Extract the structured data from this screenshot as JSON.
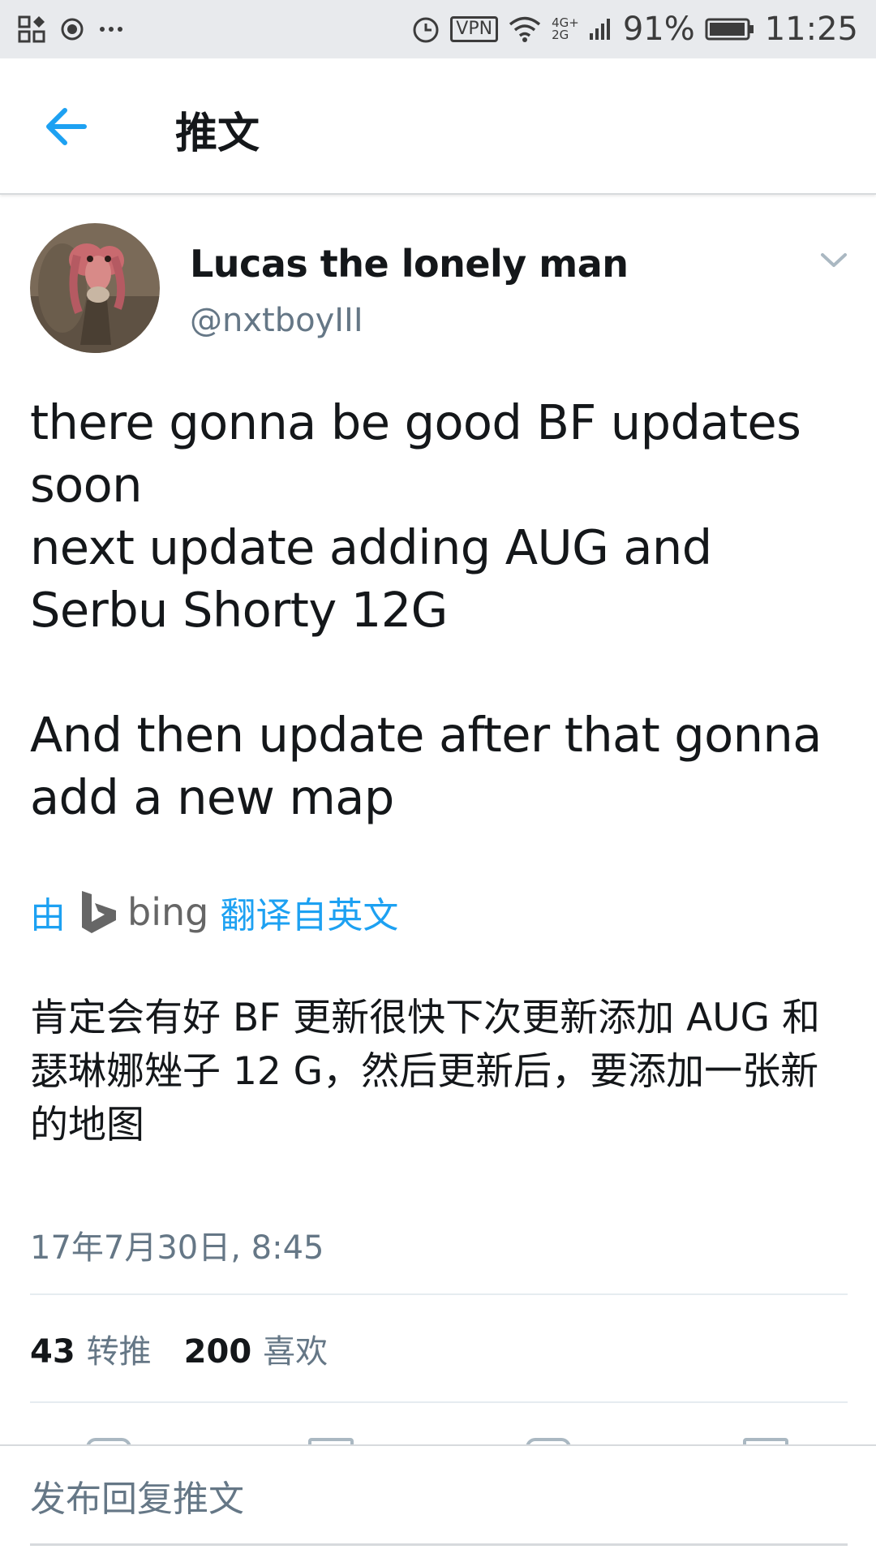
{
  "status_bar": {
    "vpn_label": "VPN",
    "network_top": "4G+",
    "network_bottom": "2G",
    "sim_slot": "2",
    "battery": "91%",
    "time": "11:25",
    "left_icons": [
      "app-grid-icon",
      "record-icon",
      "more-dots-icon"
    ],
    "right_icons": [
      "alarm-icon",
      "vpn-icon",
      "wifi-icon",
      "signal-icon",
      "battery-icon"
    ]
  },
  "header": {
    "title": "推文",
    "back_icon": "arrow-left-icon",
    "accent_color": "#1da1f2"
  },
  "tweet": {
    "author_name": "Lucas the lonely man",
    "author_handle": "@nxtboyIII",
    "text": "there gonna be good BF updates soon\nnext update adding AUG and Serbu Shorty 12G\n\nAnd then update after that gonna add a new map",
    "translate": {
      "prefix": "由",
      "provider": "bing",
      "suffix": "翻译自英文"
    },
    "translated_text": "肯定会有好 BF 更新很快下次更新添加 AUG 和瑟琳娜矬子 12 G，然后更新后，要添加一张新的地图",
    "timestamp": "17年7月30日, 8:45",
    "stats": {
      "retweets_count": "43",
      "retweets_label": "转推",
      "likes_count": "200",
      "likes_label": "喜欢"
    }
  },
  "reply": {
    "placeholder": "发布回复推文"
  }
}
